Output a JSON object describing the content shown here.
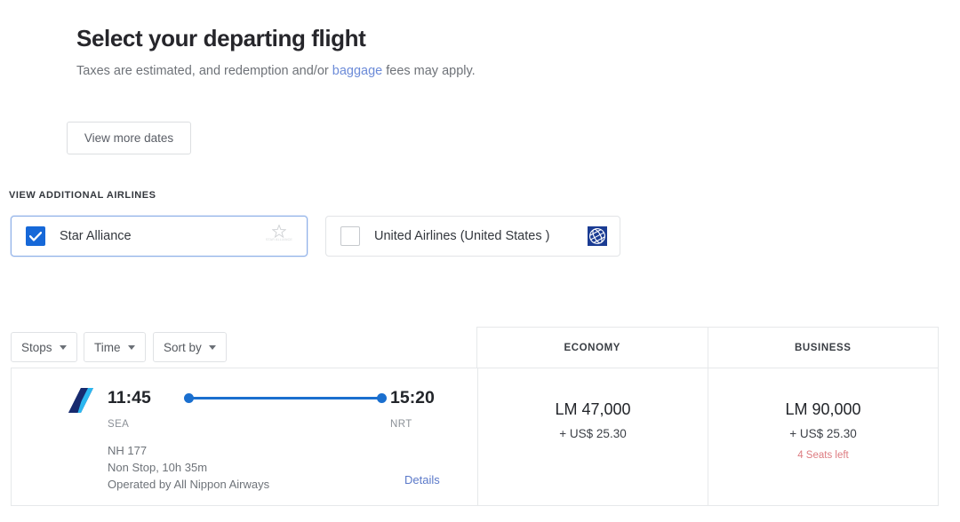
{
  "header": {
    "title": "Select your departing flight",
    "subtitle_before": "Taxes are estimated, and redemption and/or ",
    "subtitle_link": "baggage",
    "subtitle_after": " fees may apply."
  },
  "view_more_dates_label": "View more dates",
  "airlines_section": {
    "label": "VIEW ADDITIONAL AIRLINES",
    "options": [
      {
        "name": "Star Alliance",
        "checked": true,
        "logo": "star-alliance-logo",
        "logo_word": "STAR ALLIANCE"
      },
      {
        "name": "United Airlines (United States )",
        "checked": false,
        "logo": "united-airlines-logo"
      }
    ]
  },
  "filters": [
    {
      "label": "Stops",
      "icon": "chevron-down-icon"
    },
    {
      "label": "Time",
      "icon": "chevron-down-icon"
    },
    {
      "label": "Sort by",
      "icon": "chevron-down-icon"
    }
  ],
  "table": {
    "columns": [
      "ECONOMY",
      "BUSINESS"
    ],
    "flights": [
      {
        "airline_logo": "all-nippon-airways-logo",
        "depart_time": "11:45",
        "depart_code": "SEA",
        "arrive_time": "15:20",
        "arrive_code": "NRT",
        "flight_number": "NH 177",
        "stops_duration": "Non Stop, 10h 35m",
        "operated_by": "Operated by All Nippon Airways",
        "details_label": "Details",
        "fares": [
          {
            "cabin": "ECONOMY",
            "miles": "LM 47,000",
            "tax": "+ US$ 25.30",
            "seats_left": ""
          },
          {
            "cabin": "BUSINESS",
            "miles": "LM 90,000",
            "tax": "+ US$ 25.30",
            "seats_left": "4 Seats left"
          }
        ]
      }
    ]
  },
  "colors": {
    "accent_blue": "#1668d8",
    "route_blue": "#1a6fcf",
    "link_blue": "#5b79c9",
    "subtitle_link_blue": "#6c8bd8",
    "seats_red": "#dd7b80",
    "ana_navy": "#172a6e",
    "ana_cyan": "#2bb7f0",
    "united_blue": "#1b3c93",
    "border_grey": "#e6e8ea",
    "selected_border": "#8eb0e8"
  }
}
